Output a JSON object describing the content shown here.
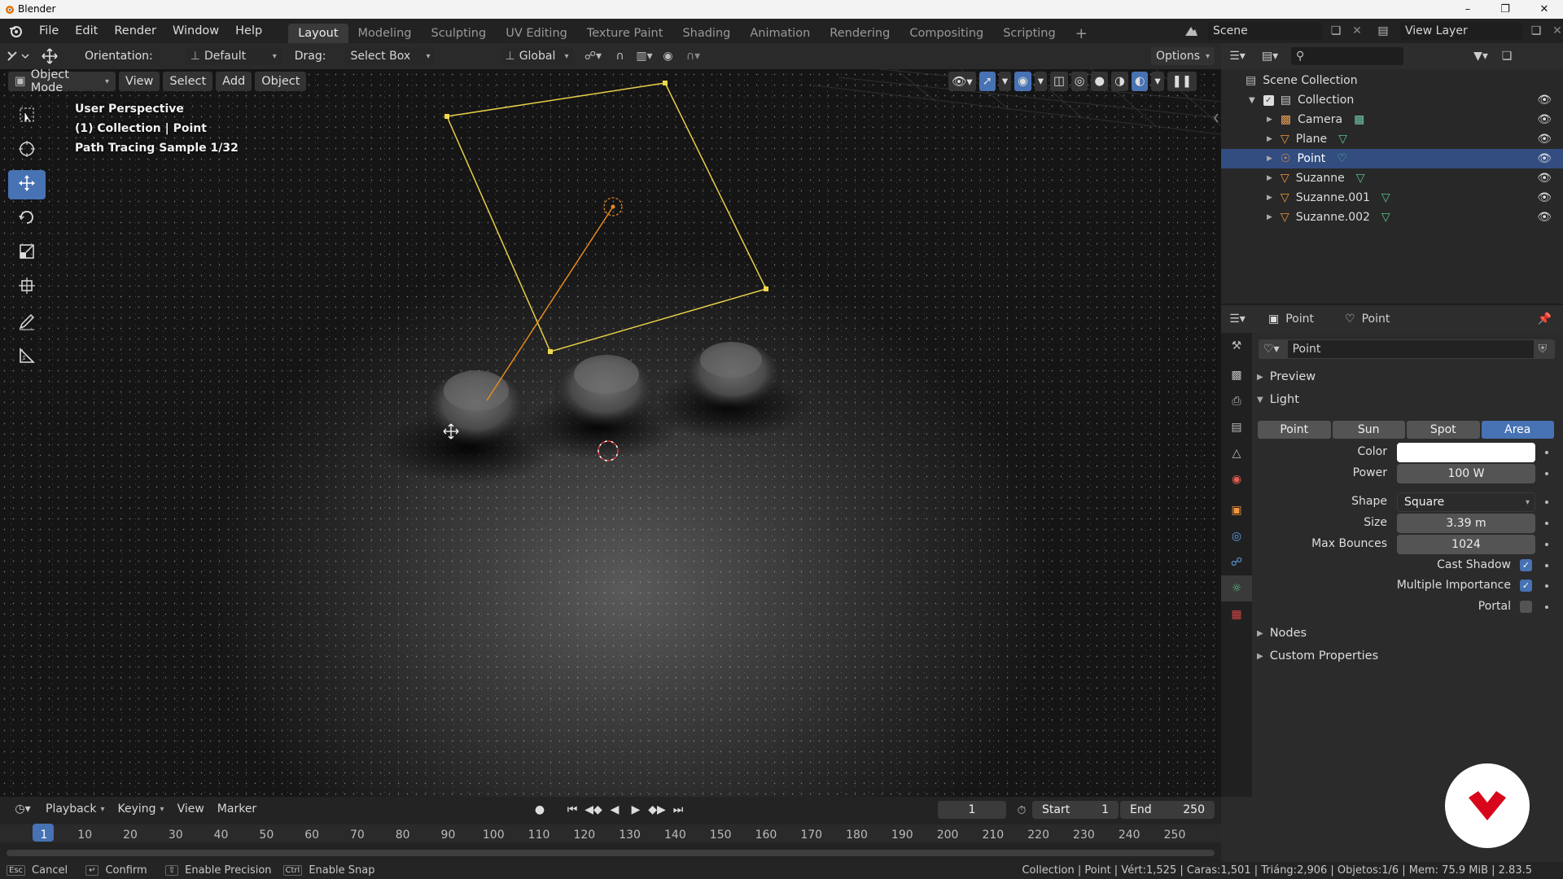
{
  "window": {
    "title": "Blender"
  },
  "menu": {
    "items": [
      "File",
      "Edit",
      "Render",
      "Window",
      "Help"
    ]
  },
  "workspaces": [
    "Layout",
    "Modeling",
    "Sculpting",
    "UV Editing",
    "Texture Paint",
    "Shading",
    "Animation",
    "Rendering",
    "Compositing",
    "Scripting"
  ],
  "scene": {
    "name": "Scene",
    "view_layer": "View Layer"
  },
  "toolheader": {
    "orientation_label": "Orientation:",
    "orientation_value": "Default",
    "drag_label": "Drag:",
    "drag_value": "Select Box",
    "transform": "Global",
    "options": "Options"
  },
  "viewport_header": {
    "mode": "Object Mode",
    "menus": [
      "View",
      "Select",
      "Add",
      "Object"
    ]
  },
  "viewport_overlay": {
    "line1": "User Perspective",
    "line2": "(1) Collection | Point",
    "line3": "Path Tracing Sample 1/32"
  },
  "outliner": {
    "root": "Scene Collection",
    "collection": "Collection",
    "items": [
      {
        "name": "Camera",
        "selected": false,
        "type": "camera"
      },
      {
        "name": "Plane",
        "selected": false,
        "type": "mesh"
      },
      {
        "name": "Point",
        "selected": true,
        "type": "light"
      },
      {
        "name": "Suzanne",
        "selected": false,
        "type": "mesh"
      },
      {
        "name": "Suzanne.001",
        "selected": false,
        "type": "mesh"
      },
      {
        "name": "Suzanne.002",
        "selected": false,
        "type": "mesh"
      }
    ]
  },
  "properties": {
    "breadcrumb_object": "Point",
    "breadcrumb_data": "Point",
    "datablock": "Point",
    "sections": {
      "preview": "Preview",
      "light": "Light",
      "nodes": "Nodes",
      "custom": "Custom Properties"
    },
    "light_types": [
      "Point",
      "Sun",
      "Spot",
      "Area"
    ],
    "light_type_active": "Area",
    "fields": {
      "color_label": "Color",
      "color_value": "#ffffff",
      "power_label": "Power",
      "power_value": "100 W",
      "shape_label": "Shape",
      "shape_value": "Square",
      "size_label": "Size",
      "size_value": "3.39 m",
      "bounces_label": "Max Bounces",
      "bounces_value": "1024",
      "cast_shadow_label": "Cast Shadow",
      "cast_shadow": true,
      "mis_label": "Multiple Importance",
      "mis": true,
      "portal_label": "Portal",
      "portal": false
    }
  },
  "timeline": {
    "menus": [
      "Playback",
      "Keying",
      "View",
      "Marker"
    ],
    "current_frame": "1",
    "start_label": "Start",
    "start": "1",
    "end_label": "End",
    "end": "250",
    "ticks": [
      "1",
      "10",
      "20",
      "30",
      "40",
      "50",
      "60",
      "70",
      "80",
      "90",
      "100",
      "110",
      "120",
      "130",
      "140",
      "150",
      "160",
      "170",
      "180",
      "190",
      "200",
      "210",
      "220",
      "230",
      "240",
      "250"
    ]
  },
  "statusbar": {
    "cancel_key": "Esc",
    "cancel": "Cancel",
    "confirm": "Confirm",
    "precision": "Enable Precision",
    "precision_key": "Shift",
    "snap_key": "Ctrl",
    "snap": "Enable Snap",
    "stats": "Collection | Point | Vért:1,525 | Caras:1,501 | Triáng:2,906 | Objetos:1/6 | Mem: 75.9 MiB | 2.83.5"
  },
  "colors": {
    "accent": "#4772b3",
    "selection": "#334d80",
    "light_outline": "#e6cf4a",
    "light_line": "#e88a1c",
    "record": "#d7061b"
  }
}
